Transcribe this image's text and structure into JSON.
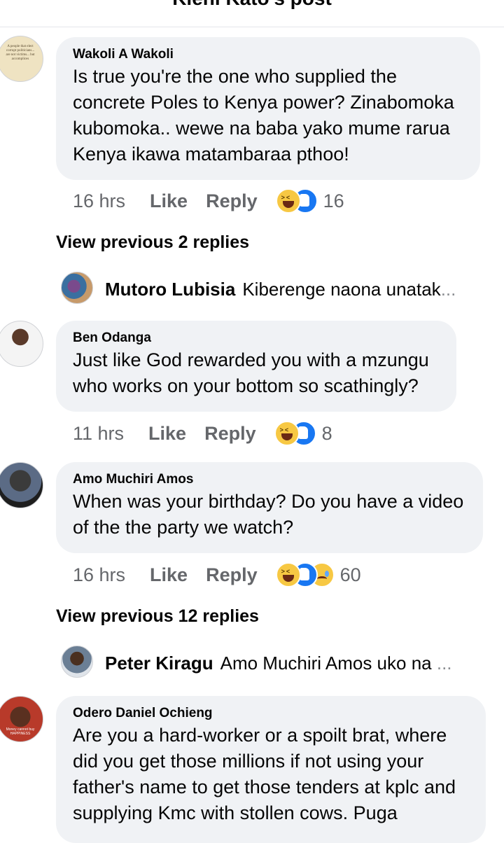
{
  "header": {
    "title": "Kieni Kato's post"
  },
  "comments": [
    {
      "author": "Wakoli A Wakoli",
      "text": "Is true you're the one who supplied the concrete Poles to Kenya power? Zinabomoka kubomoka.. wewe na baba yako mume rarua Kenya ikawa matambaraa pthoo!",
      "avatar_text": "A people that elect corrupt politicians... are not victims... but accomplices",
      "time": "16 hrs",
      "like": "Like",
      "reply": "Reply",
      "reactions": [
        "haha",
        "like"
      ],
      "reaction_count": "16"
    },
    {
      "author": "Ben Odanga",
      "text": "Just like God rewarded you with a mzungu who works on your  bottom so scathingly?",
      "time": "11 hrs",
      "like": "Like",
      "reply": "Reply",
      "reactions": [
        "haha",
        "like"
      ],
      "reaction_count": "8"
    },
    {
      "author": "Amo Muchiri Amos",
      "text": "When was your birthday? Do you have a video of the the party we watch?",
      "time": "16 hrs",
      "like": "Like",
      "reply": "Reply",
      "reactions": [
        "haha",
        "like",
        "sad"
      ],
      "reaction_count": "60"
    },
    {
      "author": "Odero Daniel Ochieng",
      "text": "Are you a hard-worker or a spoilt brat, where did you get those millions if not using your father's name to get those tenders at kplc and supplying Kmc with stollen cows. Puga",
      "avatar_text": "Money cannot buy HAPPINESS"
    }
  ],
  "view_previous": [
    "View previous 2 replies",
    "View previous 12 replies"
  ],
  "replies": [
    {
      "author": "Mutoro Lubisia",
      "text": "Kiberenge naona unatak",
      "ellipsis": "..."
    },
    {
      "author": "Peter Kiragu",
      "text": "Amo Muchiri Amos uko na ",
      "ellipsis": "..."
    }
  ],
  "colors": {
    "bubble": "#f0f2f5",
    "meta": "#65676b",
    "like_blue": "#1877f2",
    "haha_yellow": "#f7c843"
  }
}
